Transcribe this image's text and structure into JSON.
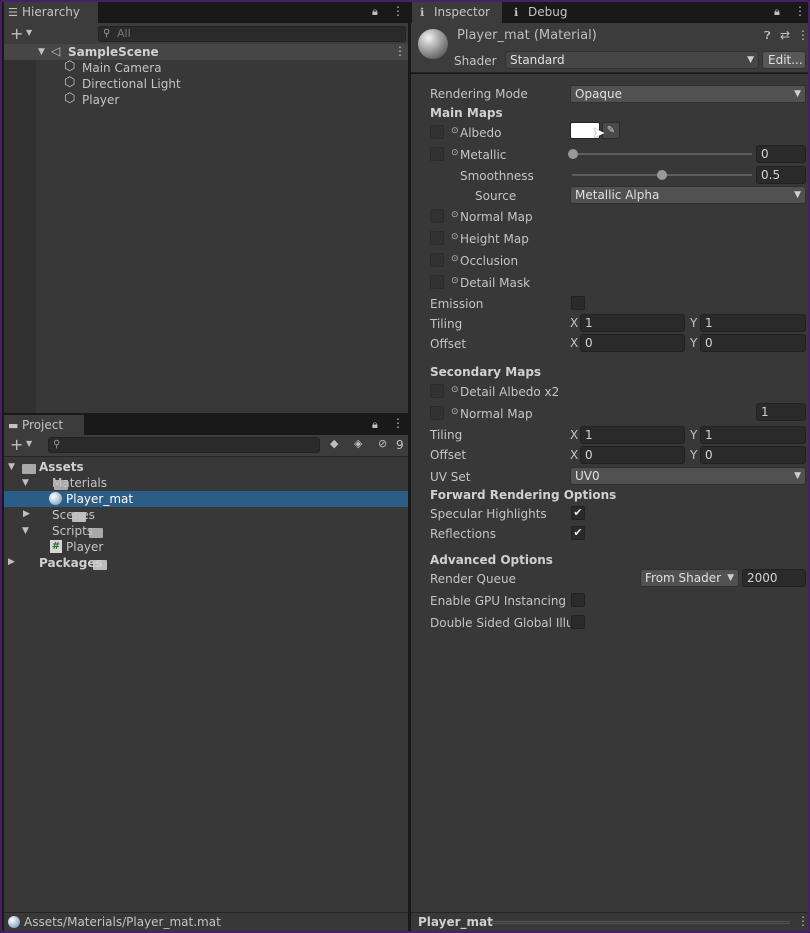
{
  "hierarchy": {
    "tab_label": "Hierarchy",
    "search_placeholder": "All",
    "scene_name": "SampleScene",
    "items": [
      "Main Camera",
      "Directional Light",
      "Player"
    ]
  },
  "project": {
    "tab_label": "Project",
    "hidden_count": "9",
    "tree": {
      "assets": "Assets",
      "materials": "Materials",
      "player_mat": "Player_mat",
      "scenes": "Scenes",
      "scripts": "Scripts",
      "player_script": "Player",
      "packages": "Packages"
    },
    "status_path": "Assets/Materials/Player_mat.mat"
  },
  "inspector": {
    "tab_label": "Inspector",
    "debug_tab_label": "Debug",
    "title": "Player_mat (Material)",
    "shader_label": "Shader",
    "shader_value": "Standard",
    "edit_button": "Edit...",
    "rendering_mode_label": "Rendering Mode",
    "rendering_mode_value": "Opaque",
    "main_maps_heading": "Main Maps",
    "albedo_label": "Albedo",
    "metallic_label": "Metallic",
    "metallic_value": "0",
    "smoothness_label": "Smoothness",
    "smoothness_value": "0.5",
    "source_label": "Source",
    "source_value": "Metallic Alpha",
    "normal_map_label": "Normal Map",
    "height_map_label": "Height Map",
    "occlusion_label": "Occlusion",
    "detail_mask_label": "Detail Mask",
    "emission_label": "Emission",
    "tiling_label": "Tiling",
    "offset_label": "Offset",
    "x_label": "X",
    "y_label": "Y",
    "main_tiling": {
      "x": "1",
      "y": "1"
    },
    "main_offset": {
      "x": "0",
      "y": "0"
    },
    "secondary_maps_heading": "Secondary Maps",
    "detail_albedo_label": "Detail Albedo x2",
    "secondary_normal_label": "Normal Map",
    "secondary_normal_value": "1",
    "secondary_tiling": {
      "x": "1",
      "y": "1"
    },
    "secondary_offset": {
      "x": "0",
      "y": "0"
    },
    "uv_set_label": "UV Set",
    "uv_set_value": "UV0",
    "forward_heading": "Forward Rendering Options",
    "specular_label": "Specular Highlights",
    "reflections_label": "Reflections",
    "advanced_heading": "Advanced Options",
    "render_queue_label": "Render Queue",
    "render_queue_source": "From Shader",
    "render_queue_value": "2000",
    "gpu_instancing_label": "Enable GPU Instancing",
    "double_sided_label": "Double Sided Global Illun",
    "footer_name": "Player_mat",
    "specular_checked": true,
    "reflections_checked": true,
    "metallic_fraction": 0.0,
    "smoothness_fraction": 0.5
  },
  "colors": {
    "selection": "#2c5d87",
    "albedo_swatch": "#ffffff"
  }
}
